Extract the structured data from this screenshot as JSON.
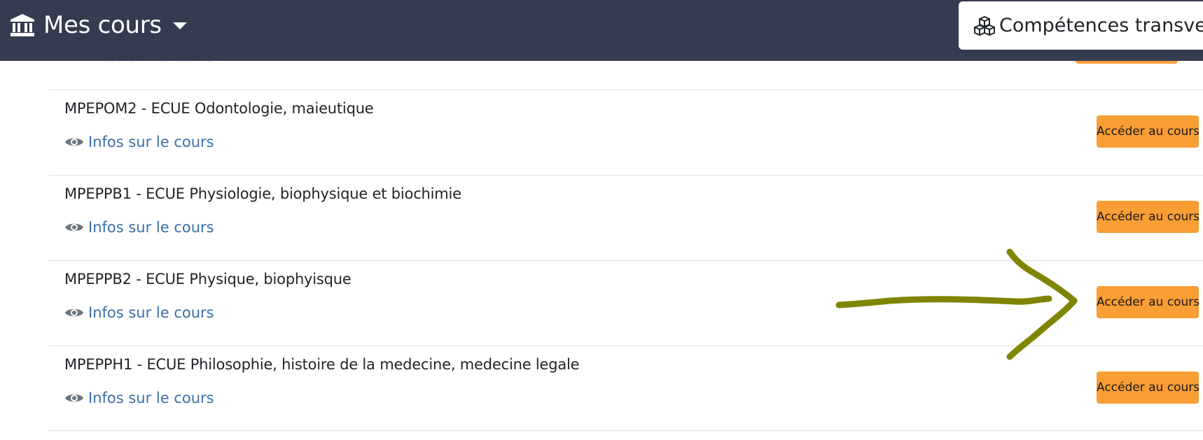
{
  "header": {
    "title": "Mes cours",
    "skills_button_label": "Compétences transvers"
  },
  "partial_row": {
    "info_label": "Infos sur le cours"
  },
  "courses": [
    {
      "title": "MPEPOM2 - ECUE Odontologie, maieutique",
      "info_label": "Infos sur le cours",
      "button_label": "Accéder au cours"
    },
    {
      "title": "MPEPPB1 - ECUE Physiologie, biophysique et biochimie",
      "info_label": "Infos sur le cours",
      "button_label": "Accéder au cours"
    },
    {
      "title": "MPEPPB2 - ECUE Physique, biophyisque",
      "info_label": "Infos sur le cours",
      "button_label": "Accéder au cours"
    },
    {
      "title": "MPEPPH1 - ECUE Philosophie, histoire de la medecine, medecine legale",
      "info_label": "Infos sur le cours",
      "button_label": "Accéder au cours"
    }
  ],
  "colors": {
    "navbar": "#353b50",
    "button": "#f99d35",
    "link": "#3b6fa8",
    "annotation": "#7f8500"
  },
  "icons": {
    "header": "bank-icon",
    "skills": "cubes-icon",
    "info": "eye-icon",
    "menu": "caret-down-icon"
  }
}
